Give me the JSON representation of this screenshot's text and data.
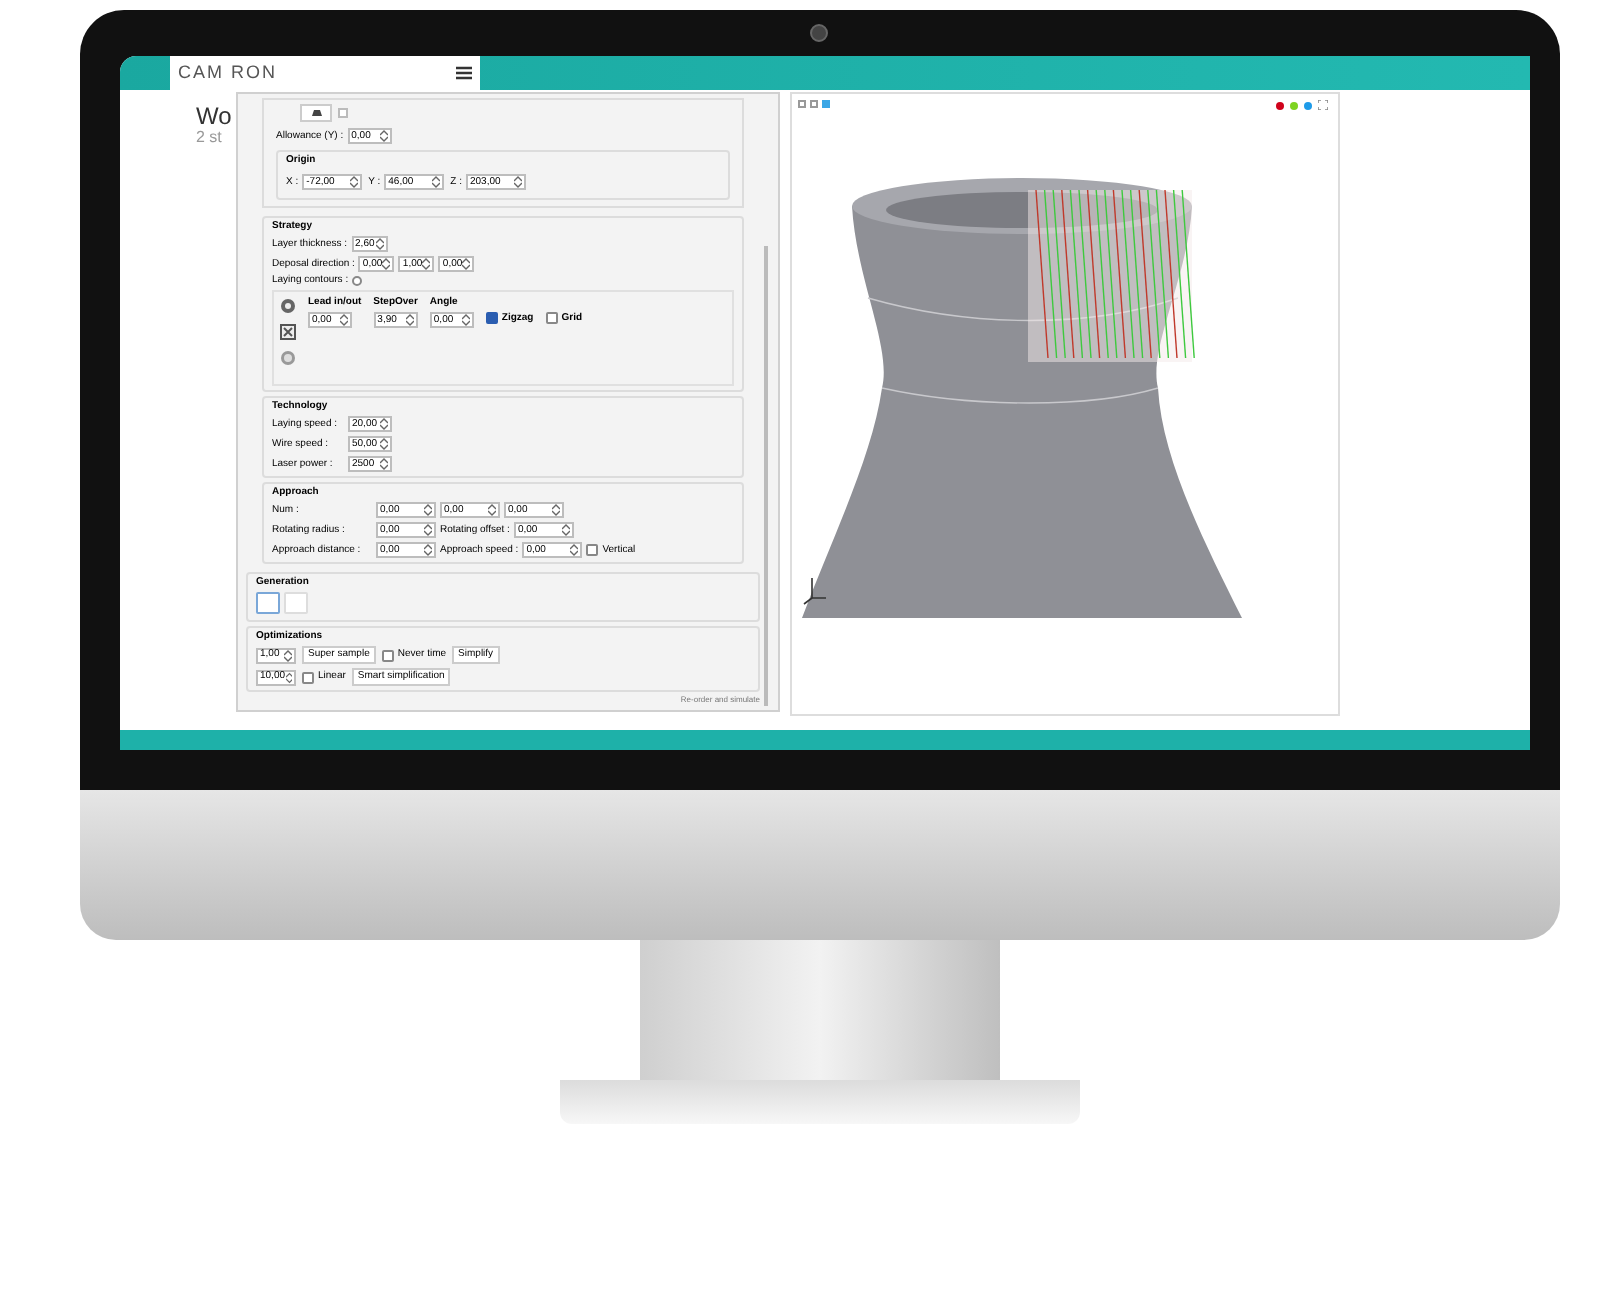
{
  "header": {
    "logo": "CAM RON"
  },
  "page": {
    "title": "Wo",
    "subtitle": "2 st"
  },
  "dialog": {
    "tool_checkbox": {
      "checked": false
    },
    "allowance": {
      "label": "Allowance (Y) :",
      "value": "0,00"
    },
    "origin": {
      "title": "Origin",
      "fields": [
        {
          "label": "X :",
          "value": "-72,00"
        },
        {
          "label": "Y :",
          "value": "46,00"
        },
        {
          "label": "Z :",
          "value": "203,00"
        }
      ]
    },
    "strategy": {
      "title": "Strategy",
      "fields": [
        {
          "label": "Layer thickness :",
          "values": [
            "2,60"
          ]
        },
        {
          "label": "Deposal direction :",
          "values": [
            "0,00",
            "1,00",
            "0,00"
          ]
        }
      ],
      "laying_contours": {
        "label": "Laying contours :",
        "checked": false
      },
      "columns": [
        {
          "label": "Lead in/out",
          "value": "0,00"
        },
        {
          "label": "StepOver",
          "value": "3,90"
        },
        {
          "label": "Angle",
          "value": "0,00"
        }
      ],
      "patterns": [
        {
          "label": "Zigzag",
          "selected": true
        },
        {
          "label": "Grid",
          "selected": false
        }
      ]
    },
    "technology": {
      "title": "Technology",
      "fields": [
        {
          "label": "Laying speed :",
          "value": "20,00"
        },
        {
          "label": "Wire speed :",
          "value": "50,00"
        },
        {
          "label": "Laser power :",
          "value": "2500"
        }
      ]
    },
    "approach": {
      "title": "Approach",
      "rows": [
        {
          "fields": [
            {
              "label": "Num :",
              "value": "0,00"
            },
            {
              "value": "0,00"
            },
            {
              "value": "0,00"
            }
          ]
        },
        {
          "fields": [
            {
              "label": "Rotating radius :",
              "value": "0,00"
            },
            {
              "label": "Rotating offset :",
              "value": "0,00"
            }
          ]
        },
        {
          "fields": [
            {
              "label": "Approach distance :",
              "value": "0,00"
            },
            {
              "label": "Approach speed :",
              "value": "0,00"
            }
          ],
          "checkbox": {
            "label": "Vertical",
            "checked": false
          }
        }
      ]
    },
    "generation": {
      "title": "Generation"
    },
    "optimizations": {
      "title": "Optimizations",
      "rows": [
        {
          "value": "1,00",
          "items": [
            {
              "kind": "button",
              "label": "Super sample"
            },
            {
              "kind": "checkbox",
              "label": "Never time",
              "checked": false
            },
            {
              "kind": "button",
              "label": "Simplify"
            }
          ]
        },
        {
          "value": "10,00",
          "items": [
            {
              "kind": "checkbox",
              "label": "Linear",
              "checked": false
            },
            {
              "kind": "button",
              "label": "Smart simplification"
            }
          ]
        }
      ]
    },
    "footer_link": "Re-order and simulate"
  },
  "viewport": {
    "view_buttons": [
      {
        "selected": false
      },
      {
        "selected": false
      },
      {
        "selected": true
      }
    ],
    "dots": [
      {
        "color": "#d0021b"
      },
      {
        "color": "#7ed321"
      },
      {
        "color": "#1e9be9"
      }
    ]
  }
}
